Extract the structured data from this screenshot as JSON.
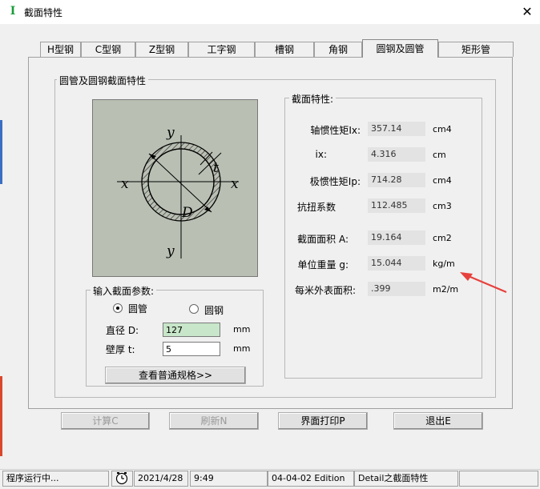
{
  "window": {
    "title": "截面特性",
    "app_icon_glyph": "I"
  },
  "tabs": [
    "H型钢",
    "C型钢",
    "Z型钢",
    "工字钢",
    "槽钢",
    "角钢",
    "圆钢及圆管",
    "矩形管"
  ],
  "active_tab_index": 6,
  "section_group": {
    "title": "圆管及圆钢截面特性"
  },
  "diagram": {
    "label_y_top": "y",
    "label_y_bottom": "y",
    "label_x_left": "x",
    "label_x_right": "x",
    "label_t": "t",
    "label_D": "D"
  },
  "input_group": {
    "title": "输入截面参数:",
    "radio_pipe": "圆管",
    "radio_bar": "圆钢",
    "selected": "pipe",
    "diameter_label": "直径 D:",
    "diameter_value": "127",
    "diameter_unit": "mm",
    "thickness_label": "壁厚 t:",
    "thickness_value": "5",
    "thickness_unit": "mm",
    "lookup_button": "查看普通规格>>"
  },
  "props_group": {
    "title": "截面特性:",
    "rows": [
      {
        "label": "轴惯性矩Ix:",
        "value": "357.14",
        "unit": "cm4"
      },
      {
        "label": "ix:",
        "value": "4.316",
        "unit": "cm"
      },
      {
        "label": "极惯性矩Ip:",
        "value": "714.28",
        "unit": "cm4"
      },
      {
        "label": "抗扭系数",
        "value": "112.485",
        "unit": "cm3"
      },
      {
        "label": "截面面积 A:",
        "value": "19.164",
        "unit": "cm2"
      },
      {
        "label": "单位重量 g:",
        "value": "15.044",
        "unit": "kg/m"
      },
      {
        "label": "每米外表面积:",
        "value": ".399",
        "unit": "m2/m"
      }
    ],
    "arrow_color": "#e8413c"
  },
  "buttons": {
    "calc": "计算C",
    "refresh": "刷新N",
    "print": "界面打印P",
    "exit": "退出E"
  },
  "statusbar": {
    "status": "程序运行中...",
    "date": "2021/4/28",
    "time": "9:49",
    "edition": "04-04-02 Edition",
    "module": "Detail之截面特性"
  }
}
